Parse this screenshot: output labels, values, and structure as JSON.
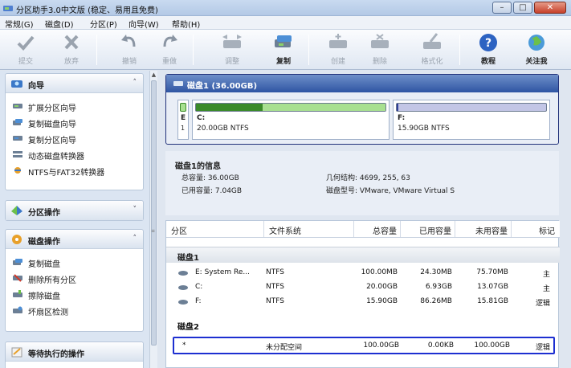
{
  "window": {
    "title": "分区助手3.0中文版 (稳定、易用且免费)"
  },
  "menu": [
    "常规(G)",
    "磁盘(D)",
    "分区(P)",
    "向导(W)",
    "帮助(H)"
  ],
  "toolbar": {
    "commit": "提交",
    "discard": "放弃",
    "undo": "撤销",
    "redo": "重做",
    "resize": "调整",
    "copy": "复制",
    "create": "创建",
    "delete": "删除",
    "format": "格式化",
    "tutorial": "教程",
    "follow": "关注我"
  },
  "sidebar": {
    "wizard": {
      "title": "向导",
      "items": [
        "扩展分区向导",
        "复制磁盘向导",
        "复制分区向导",
        "动态磁盘转换器",
        "NTFS与FAT32转换器"
      ]
    },
    "partition_ops": {
      "title": "分区操作"
    },
    "disk_ops": {
      "title": "磁盘操作",
      "items": [
        "复制磁盘",
        "删除所有分区",
        "擦除磁盘",
        "坏扇区检测"
      ]
    },
    "pending": {
      "title": "等待执行的操作"
    }
  },
  "disk_map": {
    "title": "磁盘1 (36.00GB)",
    "segments": [
      {
        "label1": "E",
        "label2": "1"
      },
      {
        "label1": "C:",
        "label2": "20.00GB NTFS",
        "used_fraction": 0.35
      },
      {
        "label1": "F:",
        "label2": "15.90GB NTFS",
        "used_fraction": 0.01
      }
    ]
  },
  "disk_info": {
    "title": "磁盘1的信息",
    "total": "总容量: 36.00GB",
    "used": "已用容量: 7.04GB",
    "geometry": "几何结构: 4699, 255, 63",
    "model": "磁盘型号: VMware, VMware Virtual S"
  },
  "table": {
    "headers": [
      "分区",
      "文件系统",
      "总容量",
      "已用容量",
      "未用容量",
      "标记"
    ],
    "group1": "磁盘1",
    "rows1": [
      [
        "E:  System Re...",
        "NTFS",
        "100.00MB",
        "24.30MB",
        "75.70MB",
        "主"
      ],
      [
        "C:",
        "NTFS",
        "20.00GB",
        "6.93GB",
        "13.07GB",
        "主"
      ],
      [
        "F:",
        "NTFS",
        "15.90GB",
        "86.26MB",
        "15.81GB",
        "逻辑"
      ]
    ],
    "group2": "磁盘2",
    "rows2": [
      [
        "*",
        "未分配空间",
        "100.00GB",
        "0.00KB",
        "100.00GB",
        "逻辑"
      ]
    ]
  }
}
